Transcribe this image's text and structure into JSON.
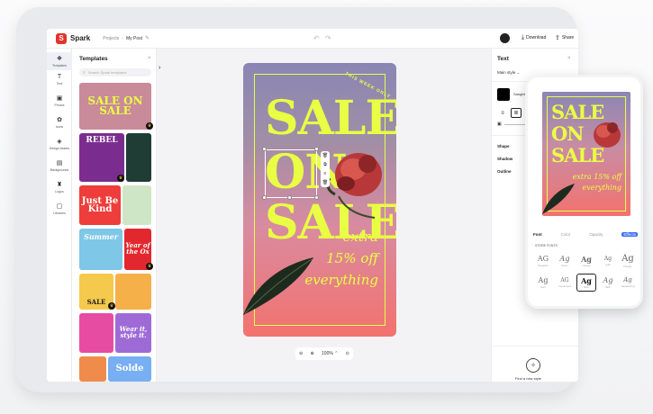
{
  "app": {
    "logo_letter": "S",
    "name": "Spark"
  },
  "breadcrumb": {
    "parent": "Projects",
    "separator": "›",
    "current": "My Post"
  },
  "header": {
    "undo_redo": "↶ ↷",
    "download_label": "Download",
    "share_label": "Share"
  },
  "rail": {
    "items": [
      {
        "icon": "❖",
        "label": "Templates"
      },
      {
        "icon": "T",
        "label": "Text"
      },
      {
        "icon": "▣",
        "label": "Photos"
      },
      {
        "icon": "✿",
        "label": "Icons"
      },
      {
        "icon": "◈",
        "label": "Design Assets"
      },
      {
        "icon": "▤",
        "label": "Backgrounds"
      },
      {
        "icon": "♜",
        "label": "Logos"
      },
      {
        "icon": "▢",
        "label": "Libraries"
      }
    ]
  },
  "templates": {
    "title": "Templates",
    "close": "×",
    "search_placeholder": "Search Spark templates",
    "thumbs": [
      {
        "text": "SALE ON SALE",
        "bg": "#c98a9a",
        "fg": "#e9ff44"
      },
      {
        "text": "REBEL",
        "bg": "#7b2d8f",
        "fg": "#ffffff"
      },
      {
        "text": "",
        "bg": "#1f3d35",
        "fg": "#d9ff4a"
      },
      {
        "text": "Just Be Kind",
        "bg": "#ee3d3a",
        "fg": "#ffffff"
      },
      {
        "text": "",
        "bg": "#cfe6c6",
        "fg": "#333"
      },
      {
        "text": "Summer",
        "bg": "#7ec7e6",
        "fg": "#ffffff"
      },
      {
        "text": "Year of the Ox",
        "bg": "#e2282e",
        "fg": "#ffffff"
      },
      {
        "text": "SALE",
        "bg": "#f4c94c",
        "fg": "#1b1b1b"
      },
      {
        "text": "",
        "bg": "#f6b04a",
        "fg": "#ffffff"
      },
      {
        "text": "",
        "bg": "#e74ca3",
        "fg": "#ffffff"
      },
      {
        "text": "Wear it, style it.",
        "bg": "#9e6bd6",
        "fg": "#ffffff"
      },
      {
        "text": "",
        "bg": "#f08c4b",
        "fg": "#ffffff"
      },
      {
        "text": "Solde",
        "bg": "#78aef2",
        "fg": "#ffffff"
      }
    ],
    "crown_icon": "♛"
  },
  "poster": {
    "word1": "SALE",
    "word2": "ON",
    "word3": "SALE",
    "tagline": "THIS WEEK ONLY",
    "extra1": "extra",
    "extra2": "15% off",
    "extra3": "everything",
    "frame_color": "#e4ff4e",
    "gradient_top": "#8a86b4",
    "gradient_bottom": "#f3726e"
  },
  "mini_toolbar": [
    "🗑",
    "⧉",
    "≡",
    "🗑"
  ],
  "zoom": {
    "zoom_out": "⊖",
    "zoom_in": "⊕",
    "value": "100% ⌃",
    "fit": "⊙"
  },
  "right_panel": {
    "title": "Text",
    "close": "×",
    "style_label": "Main style ⌄",
    "font_name": "Sangbleu Bold",
    "align": [
      "≡",
      "≣",
      "≡",
      "◌ ⌄"
    ],
    "shape_label": "Shape",
    "shadow_label": "Shadow",
    "outline_label": "Outline",
    "magic_icon": "✧",
    "magic_label": "Find a new style"
  },
  "phone": {
    "word1": "SALE",
    "word2": "ON",
    "word3": "SALE",
    "extra1": "extra 15% off",
    "extra2": "everything",
    "tabs": [
      "Font",
      "Color",
      "Opacity",
      "Effects"
    ],
    "sub_label": "STORE FONTS",
    "tiles": [
      {
        "ag": "AG",
        "label": "Sangbleu"
      },
      {
        "ag": "Ag",
        "label": "Script"
      },
      {
        "ag": "Ag",
        "label": "Canela"
      },
      {
        "ag": "Ag",
        "label": "Light"
      },
      {
        "ag": "Ag",
        "label": "Display"
      },
      {
        "ag": "Ag",
        "label": "Serif"
      },
      {
        "ag": "AG",
        "label": "Condensed"
      },
      {
        "ag": "Ag",
        "label": "Bold"
      },
      {
        "ag": "Ag",
        "label": "Italic"
      },
      {
        "ag": "Ag",
        "label": "Handwriting"
      }
    ]
  }
}
